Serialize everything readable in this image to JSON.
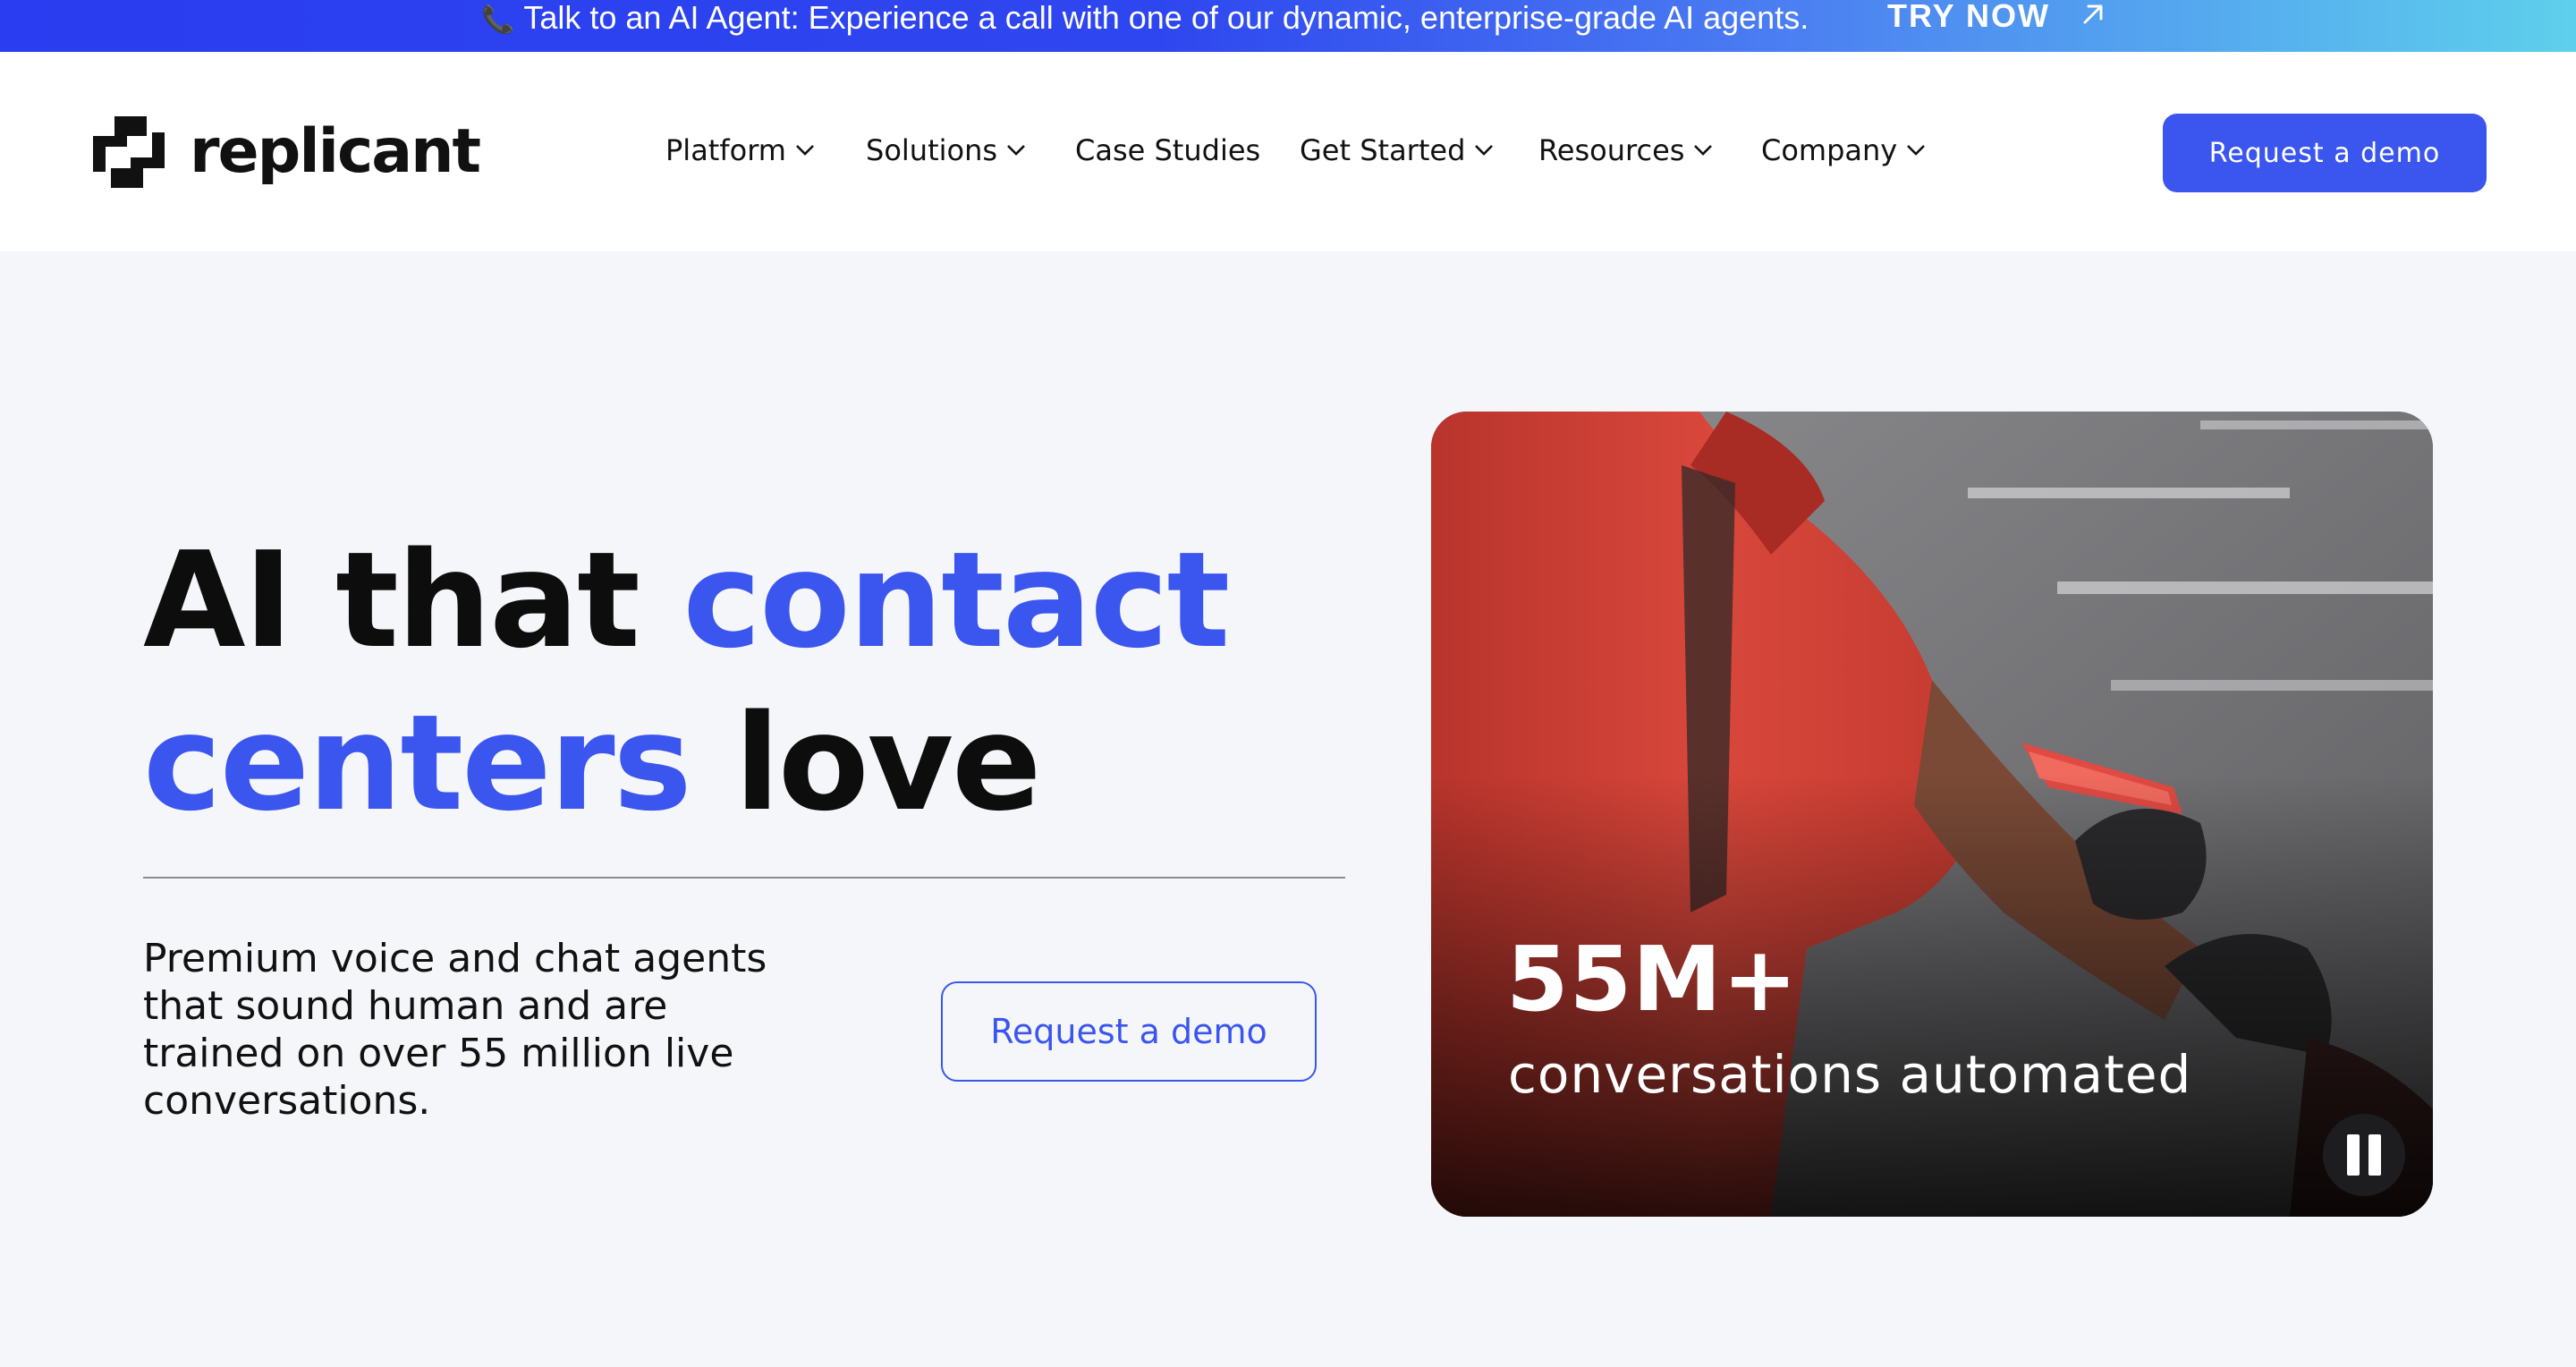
{
  "announcement": {
    "text": "Talk to an AI Agent: Experience a call with one of our dynamic, enterprise-grade AI agents.",
    "icon": "phone-icon",
    "link_label": "TRY NOW",
    "link_icon": "arrow-up-right-icon"
  },
  "header": {
    "logo_text": "replicant",
    "nav": [
      {
        "label": "Platform",
        "has_dropdown": true
      },
      {
        "label": "Solutions",
        "has_dropdown": true
      },
      {
        "label": "Case Studies",
        "has_dropdown": false
      },
      {
        "label": "Get Started",
        "has_dropdown": true
      },
      {
        "label": "Resources",
        "has_dropdown": true
      },
      {
        "label": "Company",
        "has_dropdown": true
      }
    ],
    "cta_label": "Request a demo"
  },
  "hero": {
    "title_part1": "AI that ",
    "title_accent1": "contact",
    "title_accent2": "centers",
    "title_part2": " love",
    "description": "Premium voice and chat agents that sound human and are trained on over 55 million live conversations.",
    "cta_label": "Request a demo"
  },
  "video": {
    "stat_number": "55M+",
    "stat_label": "conversations automated",
    "control_icon": "pause-icon"
  },
  "colors": {
    "accent": "#3b55ef",
    "background": "#f5f6fa",
    "text": "#111111"
  }
}
